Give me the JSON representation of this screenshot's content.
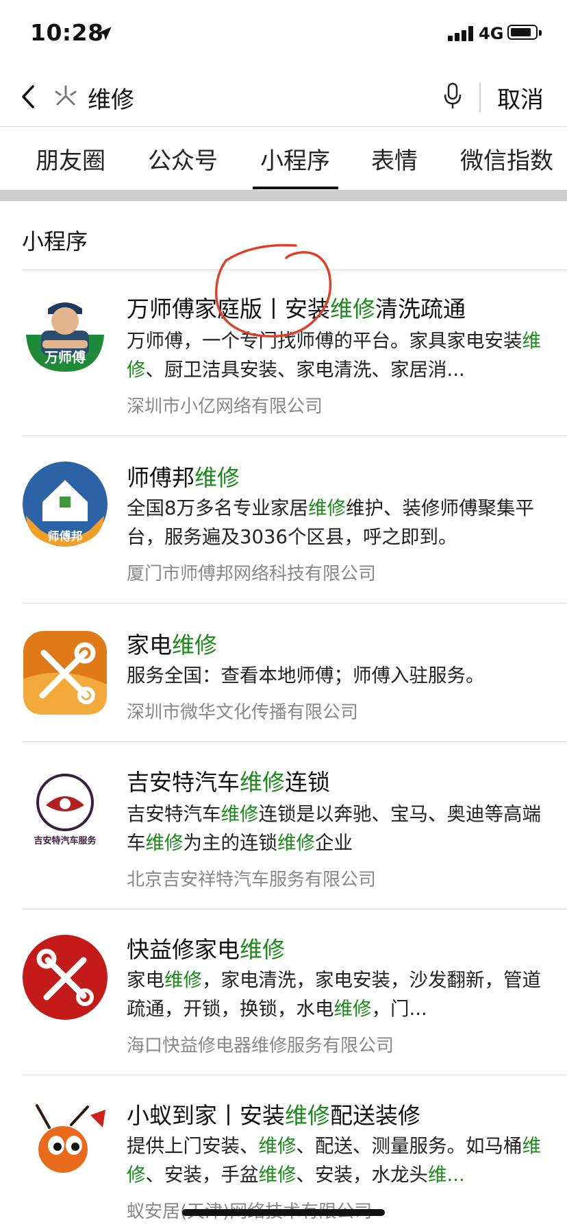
{
  "status": {
    "time": "10:28",
    "network": "4G",
    "battery_level": 0.85
  },
  "search": {
    "query": "维修",
    "cancel_label": "取消"
  },
  "tabs": [
    {
      "label": "朋友圈"
    },
    {
      "label": "公众号"
    },
    {
      "label": "小程序",
      "selected": true
    },
    {
      "label": "表情"
    },
    {
      "label": "微信指数"
    }
  ],
  "section": {
    "title": "小程序"
  },
  "results": [
    {
      "title": [
        "万师傅家庭版丨安装",
        "维修",
        "清洗疏通"
      ],
      "desc": [
        "万师傅，一个专门找师傅的平台。家具家电安装",
        "维修",
        "、厨卫洁具安装、家电清洗、家居消..."
      ],
      "company": "深圳市小亿网络有限公司",
      "logo_text": "万师傅"
    },
    {
      "title": [
        "师傅邦",
        "维修",
        ""
      ],
      "desc": [
        "全国8万多名专业家居",
        "维修",
        "维护、装修师傅聚集平台，服务遍及3036个区县，呼之即到。"
      ],
      "company": "厦门市师傅邦网络科技有限公司",
      "logo_text": "师傅邦"
    },
    {
      "title": [
        "家电",
        "维修",
        ""
      ],
      "desc": [
        "服务全国：查看本地师傅；师傅入驻服务。",
        "",
        ""
      ],
      "company": "深圳市微华文化传播有限公司",
      "logo_text": ""
    },
    {
      "title": [
        "吉安特汽车",
        "维修",
        "连锁"
      ],
      "desc": [
        "吉安特汽车",
        "维修",
        "连锁是以奔驰、宝马、奥迪等高端车",
        "维修",
        "为主的连锁",
        "维修",
        "企业"
      ],
      "company": "北京吉安祥特汽车服务有限公司",
      "logo_text": "吉安特汽车服务"
    },
    {
      "title": [
        "快益修家电",
        "维修",
        ""
      ],
      "desc": [
        "家电",
        "维修",
        "，家电清洗，家电安装，沙发翻新，管道疏通，开锁，换锁，水电",
        "维修",
        "，门..."
      ],
      "company": "海口快益修电器维修服务有限公司",
      "logo_text": ""
    },
    {
      "title": [
        "小蚁到家丨安装",
        "维修",
        "配送装修"
      ],
      "desc": [
        "提供上门安装、",
        "维修",
        "、配送、测量服务。如马桶",
        "维修",
        "、安装，手盆",
        "维修",
        "、安装，水龙头",
        "维..."
      ],
      "company": "蚁安居(天津)网络技术有限公司",
      "logo_text": ""
    }
  ],
  "colors": {
    "highlight": "#1a8a1a",
    "company": "#888888",
    "annotation": "#e0402a"
  },
  "icons": [
    "back-icon",
    "search-icon",
    "mic-icon",
    "location-arrow-icon",
    "signal-icon",
    "battery-icon"
  ]
}
